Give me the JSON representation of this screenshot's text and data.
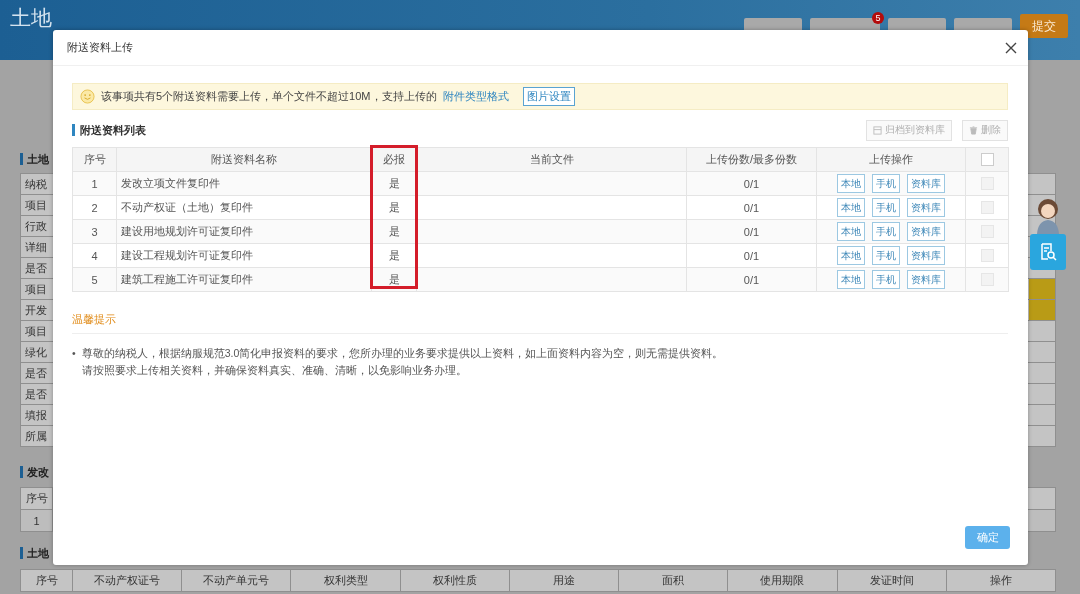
{
  "page": {
    "title": "土地",
    "buttons": [
      {
        "kind": "plain"
      },
      {
        "kind": "plain",
        "badge": "5"
      },
      {
        "kind": "plain"
      },
      {
        "kind": "plain"
      },
      {
        "kind": "primary",
        "label": "提交"
      }
    ],
    "sections": [
      {
        "heading": "土地",
        "rows": [
          {
            "label": "纳税",
            "highlighted": false
          },
          {
            "label": "项目",
            "highlighted": false
          },
          {
            "label": "行政",
            "highlighted": false
          },
          {
            "label": "详细",
            "highlighted": false
          },
          {
            "label": "是否",
            "highlighted": false
          },
          {
            "label": "项目",
            "highlighted": true
          },
          {
            "label": "开发",
            "highlighted": true
          },
          {
            "label": "项目",
            "highlighted": false
          },
          {
            "label": "绿化",
            "highlighted": false
          },
          {
            "label": "是否",
            "highlighted": false
          },
          {
            "label": "是否",
            "highlighted": false
          },
          {
            "label": "填报",
            "highlighted": false
          },
          {
            "label": "所属",
            "highlighted": false
          }
        ]
      },
      {
        "heading": "发改",
        "table": {
          "columns": [
            "序号"
          ],
          "rows": [
            [
              "1"
            ]
          ]
        }
      },
      {
        "heading": "土地",
        "table": {
          "columns": [
            "序号",
            "不动产权证号",
            "不动产单元号",
            "权利类型",
            "权利性质",
            "用途",
            "面积",
            "使用期限",
            "发证时间",
            "操作"
          ]
        }
      }
    ]
  },
  "dialog": {
    "title": "附送资料上传",
    "notice": {
      "text": "该事项共有5个附送资料需要上传，单个文件不超过10M，支持上传的",
      "link": "附件类型格式",
      "button": "图片设置"
    },
    "list_title": "附送资料列表",
    "toolbar": [
      {
        "label": "归档到资料库",
        "kind": "archive"
      },
      {
        "label": "删除",
        "kind": "delete"
      }
    ],
    "columns": [
      {
        "label": "序号",
        "highlighted": false
      },
      {
        "label": "附送资料名称",
        "highlighted": false
      },
      {
        "label": "必报",
        "highlighted": true
      },
      {
        "label": "当前文件",
        "highlighted": false
      },
      {
        "label": "上传份数/最多份数",
        "highlighted": false
      },
      {
        "label": "上传操作",
        "highlighted": false
      }
    ],
    "select_all": {
      "checked": false
    },
    "rows": [
      {
        "no": "1",
        "name": "发改立项文件复印件",
        "required": "是",
        "count": "0/1",
        "actions": [
          "本地",
          "手机",
          "资料库"
        ],
        "checked": false,
        "disabled": true
      },
      {
        "no": "2",
        "name": "不动产权证（土地）复印件",
        "required": "是",
        "count": "0/1",
        "actions": [
          "本地",
          "手机",
          "资料库"
        ],
        "checked": false,
        "disabled": true
      },
      {
        "no": "3",
        "name": "建设用地规划许可证复印件",
        "required": "是",
        "count": "0/1",
        "actions": [
          "本地",
          "手机",
          "资料库"
        ],
        "checked": false,
        "disabled": true
      },
      {
        "no": "4",
        "name": "建设工程规划许可证复印件",
        "required": "是",
        "count": "0/1",
        "actions": [
          "本地",
          "手机",
          "资料库"
        ],
        "checked": false,
        "disabled": true
      },
      {
        "no": "5",
        "name": "建筑工程施工许可证复印件",
        "required": "是",
        "count": "0/1",
        "actions": [
          "本地",
          "手机",
          "资料库"
        ],
        "checked": false,
        "disabled": true
      }
    ],
    "tips_title": "温馨提示",
    "tips": [
      {
        "marker": "•",
        "lines": [
          "尊敬的纳税人，根据纳服规范3.0简化申报资料的要求，您所办理的业务要求提供以上资料，如上面资料内容为空，则无需提供资料。",
          "请按照要求上传相关资料，并确保资料真实、准确、清晰，以免影响业务办理。"
        ]
      }
    ],
    "confirm": "确定"
  }
}
